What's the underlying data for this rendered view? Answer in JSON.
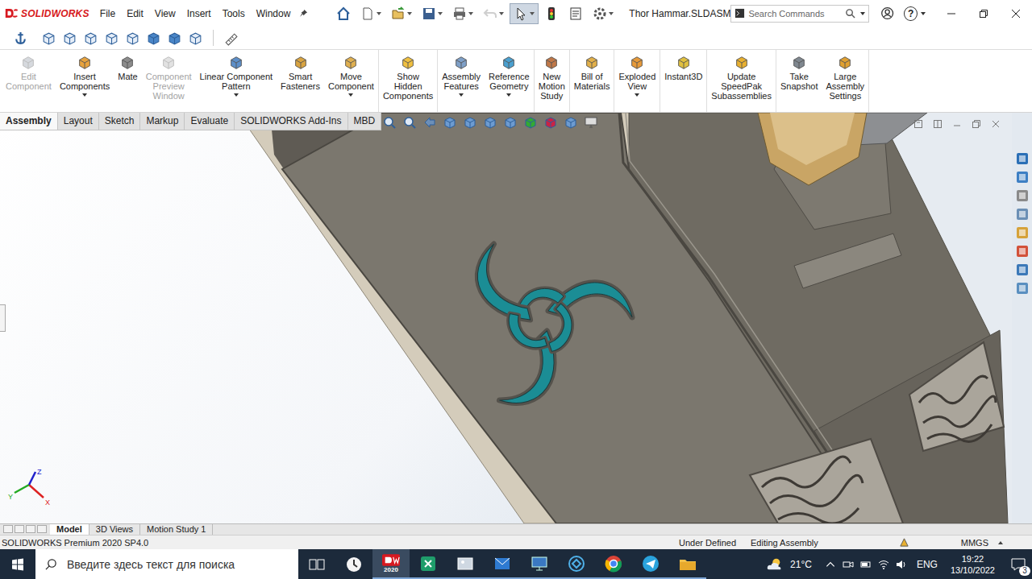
{
  "app": {
    "logo": "SOLIDWORKS"
  },
  "window": {
    "title": "Thor Hammar.SLDASM"
  },
  "menu": [
    "File",
    "Edit",
    "View",
    "Insert",
    "Tools",
    "Window"
  ],
  "search": {
    "placeholder": "Search Commands"
  },
  "help_glyph": "?",
  "ribbon": [
    {
      "lines": [
        "Edit",
        "Component"
      ],
      "disabled": true,
      "dropdown": false
    },
    {
      "lines": [
        "Insert",
        "Components"
      ],
      "disabled": false,
      "dropdown": true
    },
    {
      "lines": [
        "Mate"
      ],
      "disabled": false,
      "dropdown": false
    },
    {
      "lines": [
        "Component",
        "Preview",
        "Window"
      ],
      "disabled": true,
      "dropdown": false
    },
    {
      "lines": [
        "Linear Component",
        "Pattern"
      ],
      "disabled": false,
      "dropdown": true
    },
    {
      "lines": [
        "Smart",
        "Fasteners"
      ],
      "disabled": false,
      "dropdown": false
    },
    {
      "lines": [
        "Move",
        "Component"
      ],
      "disabled": false,
      "dropdown": true
    },
    {
      "lines": [
        "Show",
        "Hidden",
        "Components"
      ],
      "disabled": false,
      "dropdown": false
    },
    {
      "lines": [
        "Assembly",
        "Features"
      ],
      "disabled": false,
      "dropdown": true
    },
    {
      "lines": [
        "Reference",
        "Geometry"
      ],
      "disabled": false,
      "dropdown": true
    },
    {
      "lines": [
        "New",
        "Motion",
        "Study"
      ],
      "disabled": false,
      "dropdown": false
    },
    {
      "lines": [
        "Bill of",
        "Materials"
      ],
      "disabled": false,
      "dropdown": false
    },
    {
      "lines": [
        "Exploded",
        "View"
      ],
      "disabled": false,
      "dropdown": true
    },
    {
      "lines": [
        "Instant3D"
      ],
      "disabled": false,
      "dropdown": false
    },
    {
      "lines": [
        "Update",
        "SpeedPak",
        "Subassemblies"
      ],
      "disabled": false,
      "dropdown": false
    },
    {
      "lines": [
        "Take",
        "Snapshot"
      ],
      "disabled": false,
      "dropdown": false
    },
    {
      "lines": [
        "Large",
        "Assembly",
        "Settings"
      ],
      "disabled": false,
      "dropdown": false
    }
  ],
  "tabs": [
    {
      "label": "Assembly",
      "selected": true
    },
    {
      "label": "Layout",
      "selected": false
    },
    {
      "label": "Sketch",
      "selected": false
    },
    {
      "label": "Markup",
      "selected": false
    },
    {
      "label": "Evaluate",
      "selected": false
    },
    {
      "label": "SOLIDWORKS Add-Ins",
      "selected": false
    },
    {
      "label": "MBD",
      "selected": false
    }
  ],
  "triad": [
    "X",
    "Y",
    "Z"
  ],
  "bottom_tabs": [
    {
      "label": "Model",
      "selected": true
    },
    {
      "label": "3D Views",
      "selected": false
    },
    {
      "label": "Motion Study 1",
      "selected": false
    }
  ],
  "status_bar": {
    "product": "SOLIDWORKS Premium 2020 SP4.0",
    "state": "Under Defined",
    "mode": "Editing Assembly",
    "units": "MMGS"
  },
  "taskbar": {
    "search_placeholder": "Введите здесь текст для поиска",
    "sw_version": "2020",
    "temperature": "21°C",
    "language": "ENG",
    "time": "19:22",
    "date": "13/10/2022",
    "notifications": "3"
  }
}
